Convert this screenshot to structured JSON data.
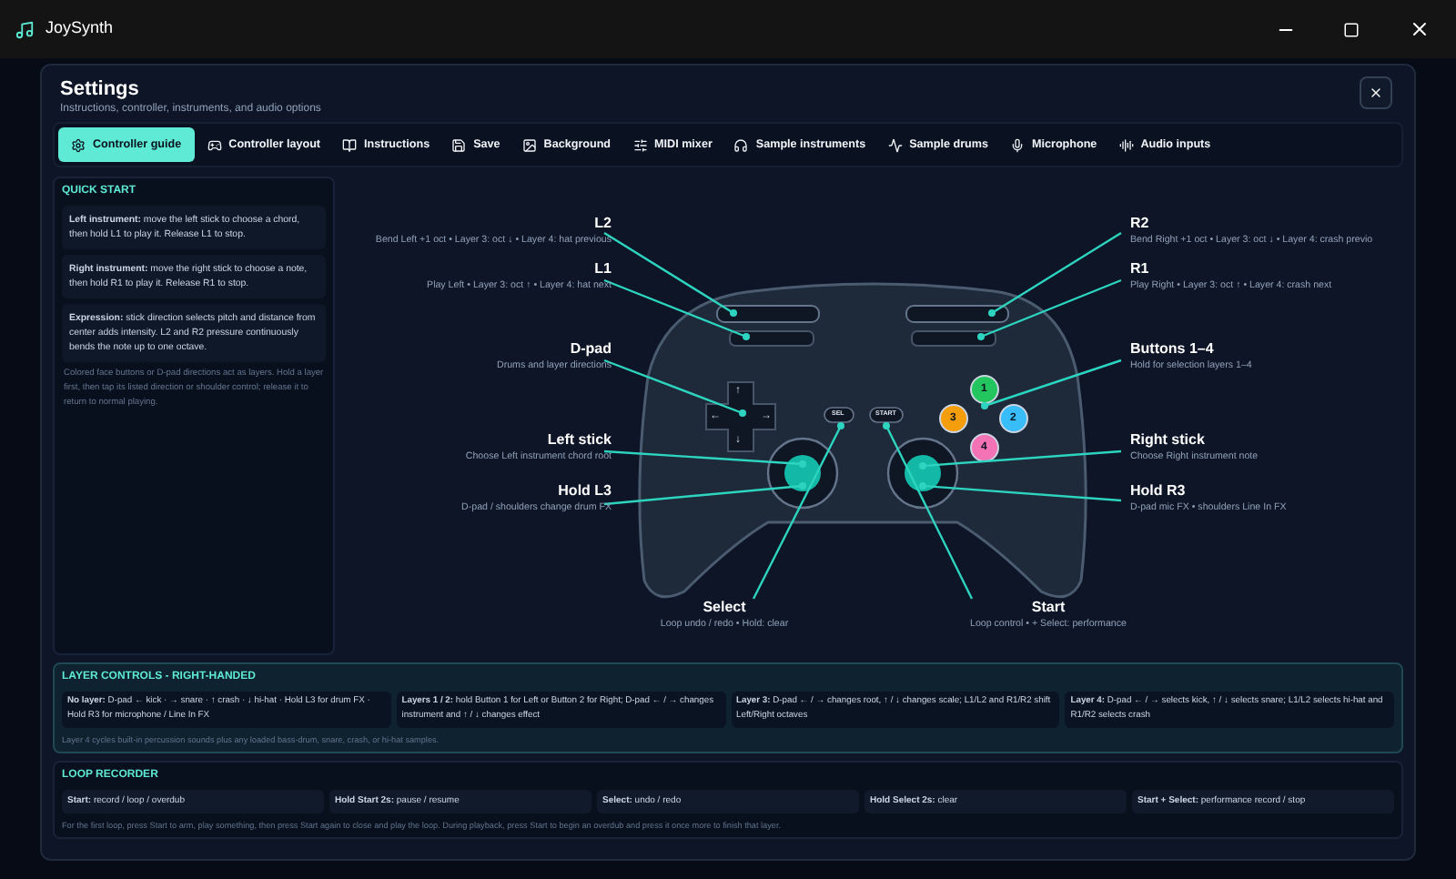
{
  "window": {
    "title": "JoySynth"
  },
  "dialog": {
    "title": "Settings",
    "subtitle": "Instructions, controller, instruments, and audio options"
  },
  "tabs": [
    {
      "label": "Controller guide",
      "selected": true
    },
    {
      "label": "Controller layout",
      "selected": false
    },
    {
      "label": "Instructions",
      "selected": false
    },
    {
      "label": "Save",
      "selected": false
    },
    {
      "label": "Background",
      "selected": false
    },
    {
      "label": "MIDI mixer",
      "selected": false
    },
    {
      "label": "Sample instruments",
      "selected": false
    },
    {
      "label": "Sample drums",
      "selected": false
    },
    {
      "label": "Microphone",
      "selected": false
    },
    {
      "label": "Audio inputs",
      "selected": false
    }
  ],
  "quick_start": {
    "title": "QUICK START",
    "items": [
      "**Left instrument:** move the left stick to choose a chord, then hold L1 to play it. Release L1 to stop.",
      "**Right instrument:** move the right stick to choose a note, then hold R1 to play it. Release R1 to stop.",
      "**Expression:** stick direction selects pitch and distance from center adds intensity. L2 and R2 pressure continuously bends the note up to one octave."
    ],
    "note": "Colored face buttons or D-pad directions act as layers. Hold a layer first, then tap its listed direction or shoulder control; release it to return to normal playing."
  },
  "diagram": {
    "callouts": [
      {
        "title": "L2",
        "description": "Bend Left +1 oct • Layer 3: oct ↓ • Layer 4: hat previous"
      },
      {
        "title": "L1",
        "description": "Play Left • Layer 3: oct ↑ • Layer 4: hat next"
      },
      {
        "title": "D-pad",
        "description": "Drums and layer directions"
      },
      {
        "title": "Left stick",
        "description": "Choose Left instrument chord root"
      },
      {
        "title": "Hold L3",
        "description": "D-pad / shoulders change drum FX"
      },
      {
        "title": "Select",
        "description": "Loop undo / redo • Hold: clear"
      },
      {
        "title": "R2",
        "description": "Bend Right +1 oct • Layer 3: oct ↓ • Layer 4: crash previo"
      },
      {
        "title": "R1",
        "description": "Play Right • Layer 3: oct ↑ • Layer 4: crash next"
      },
      {
        "title": "Buttons 1–4",
        "description": "Hold for selection layers 1–4"
      },
      {
        "title": "Right stick",
        "description": "Choose Right instrument note"
      },
      {
        "title": "Hold R3",
        "description": "D-pad mic FX • shoulders Line In FX"
      },
      {
        "title": "Start",
        "description": "Loop control • + Select: performance"
      }
    ],
    "dpad_arrows": [
      "↑",
      "←",
      "→",
      "↓"
    ],
    "select_label": "SEL",
    "start_label": "START",
    "face_buttons": [
      {
        "label": "1",
        "color": "#22c55e"
      },
      {
        "label": "3",
        "color": "#f59e0b"
      },
      {
        "label": "2",
        "color": "#38bdf8"
      },
      {
        "label": "4",
        "color": "#f472b6"
      }
    ]
  },
  "layer_controls": {
    "title": "LAYER CONTROLS - RIGHT-HANDED",
    "items": [
      "**No layer:** D-pad ← kick · → snare · ↑ crash · ↓ hi-hat · Hold L3 for drum FX · Hold R3 for microphone / Line In FX",
      "**Layers 1 / 2:** hold Button 1 for Left or Button 2 for Right; D-pad ← / → changes instrument and ↑ / ↓ changes effect",
      "**Layer 3:** D-pad ← / → changes root, ↑ / ↓ changes scale; L1/L2 and R1/R2 shift Left/Right octaves",
      "**Layer 4:** D-pad ← / → selects kick, ↑ / ↓ selects snare; L1/L2 selects hi-hat and R1/R2 selects crash"
    ],
    "note": "Layer 4 cycles built-in percussion sounds plus any loaded bass-drum, snare, crash, or hi-hat samples."
  },
  "loop_recorder": {
    "title": "LOOP RECORDER",
    "items": [
      "**Start:** record / loop / overdub",
      "**Hold Start 2s:** pause / resume",
      "**Select:** undo / redo",
      "**Hold Select 2s:** clear",
      "**Start + Select:** performance record / stop"
    ],
    "note": "For the first loop, press Start to arm, play something, then press Start again to close and play the loop. During playback, press Start to begin an overdub and press it once more to finish that layer."
  }
}
